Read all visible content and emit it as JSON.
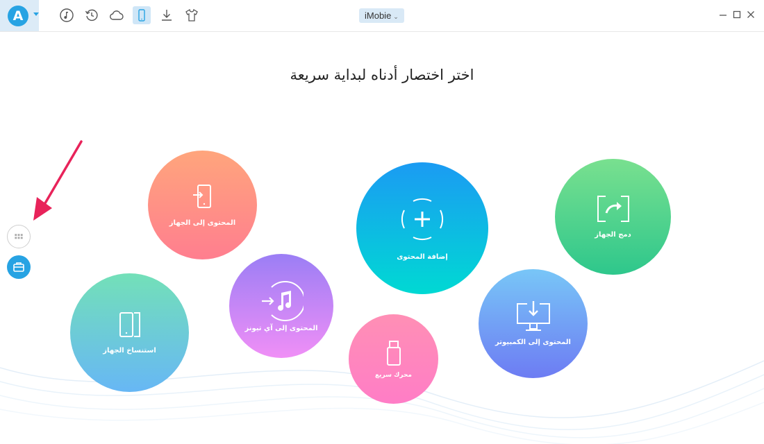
{
  "header": {
    "device_name": "iMobie",
    "logo_letter": "A",
    "toolbar_icons": [
      "music-icon",
      "restore-icon",
      "cloud-icon",
      "phone-icon",
      "download-icon",
      "tshirt-icon"
    ]
  },
  "main": {
    "heading": "اختر اختصار أدناه لبداية سريعة",
    "shortcuts": [
      {
        "label": "المحتوى إلى الجهاز",
        "icon": "phone-import-icon"
      },
      {
        "label": "المحتوى إلى آي تيونز",
        "icon": "itunes-icon"
      },
      {
        "label": "إضافة المحتوى",
        "icon": "add-icon"
      },
      {
        "label": "دمج الجهاز",
        "icon": "merge-device-icon"
      },
      {
        "label": "استنساخ الجهاز",
        "icon": "clone-device-icon"
      },
      {
        "label": "محرك سريع",
        "icon": "usb-drive-icon"
      },
      {
        "label": "المحتوى إلى الكمبيوتر",
        "icon": "computer-export-icon"
      }
    ]
  },
  "colors": {
    "brand": "#27a3e3",
    "active_tab_bg": "#cfe6f7",
    "arrow": "#e8235a"
  }
}
